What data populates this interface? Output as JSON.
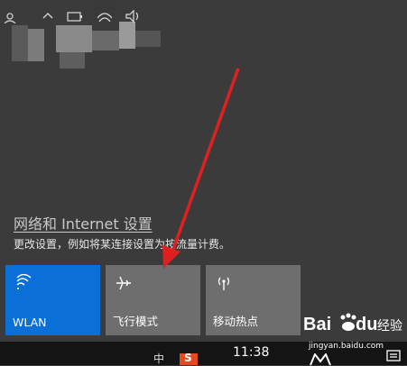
{
  "network_settings": {
    "link": "网络和 Internet 设置",
    "description": "更改设置，例如将某连接设置为按流量计费。"
  },
  "quick_actions": [
    {
      "label": "WLAN",
      "icon": "wifi-icon",
      "state": "on"
    },
    {
      "label": "飞行模式",
      "icon": "airplane-icon",
      "state": "off"
    },
    {
      "label": "移动热点",
      "icon": "hotspot-icon",
      "state": "off"
    }
  ],
  "taskbar": {
    "time": "11:38",
    "ime": "中"
  },
  "watermark": {
    "site": "jingyan.baidu.com",
    "brand": "Baidu",
    "product": "经验"
  },
  "colors": {
    "panel_bg": "#3b3b3b",
    "active_tile": "#0a6fd6",
    "inactive_tile": "#6e6e6e",
    "taskbar": "#141414",
    "arrow": "#e02020"
  }
}
